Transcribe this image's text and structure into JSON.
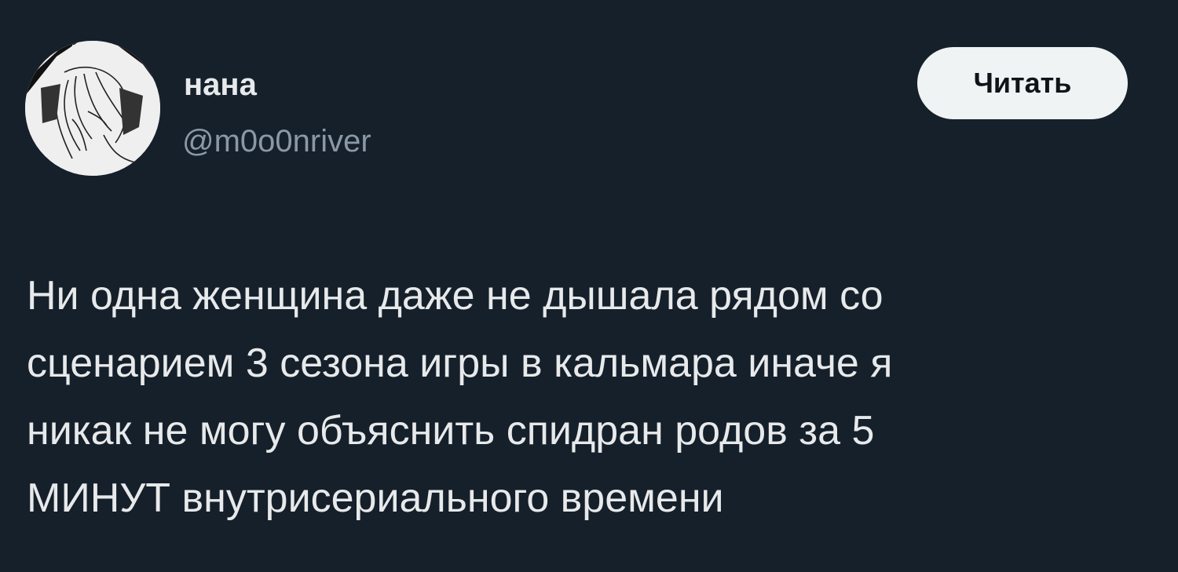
{
  "author": {
    "display_name": "нана",
    "handle": "@m0o0nriver",
    "avatar_icon": "anime-girl-avatar-icon"
  },
  "actions": {
    "follow_label": "Читать"
  },
  "tweet": {
    "lines": [
      "Ни одна женщина даже не дышала рядом со",
      "сценарием 3 сезона игры в кальмара иначе я",
      "никак не могу объяснить спидран родов за 5",
      "МИНУТ внутрисериального времени"
    ]
  },
  "colors": {
    "background": "#15202b",
    "text": "#e7e9ea",
    "secondary_text": "#8b98a5",
    "button_bg": "#eff3f4"
  }
}
